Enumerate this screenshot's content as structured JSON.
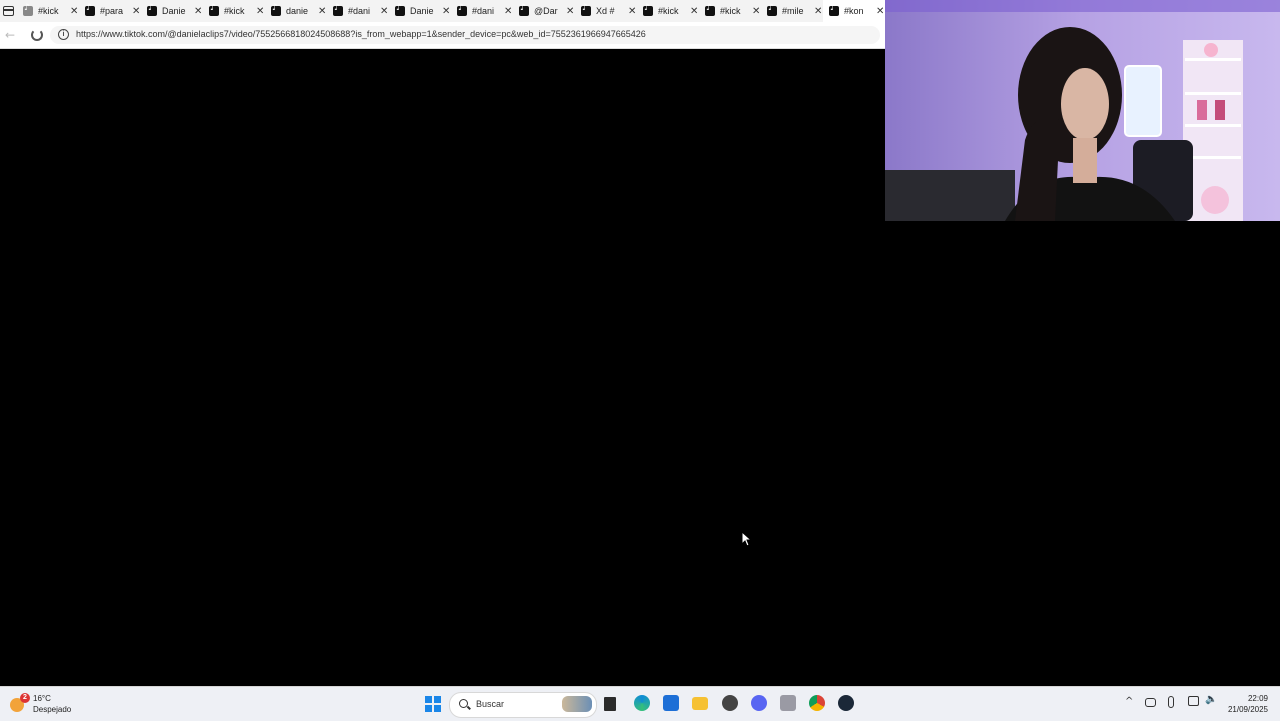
{
  "browser": {
    "tabs": [
      {
        "title": "#kick",
        "favicon": "grey-page-icon",
        "active": false
      },
      {
        "title": "#para",
        "favicon": "tiktok-icon",
        "active": false
      },
      {
        "title": "Danie",
        "favicon": "tiktok-icon",
        "active": false
      },
      {
        "title": "#kick",
        "favicon": "tiktok-icon",
        "active": false
      },
      {
        "title": "danie",
        "favicon": "tiktok-icon",
        "active": false
      },
      {
        "title": "#dani",
        "favicon": "tiktok-icon",
        "active": false
      },
      {
        "title": "Danie",
        "favicon": "tiktok-icon",
        "active": false
      },
      {
        "title": "#dani",
        "favicon": "tiktok-icon",
        "active": false
      },
      {
        "title": "@Dar",
        "favicon": "tiktok-icon",
        "active": false
      },
      {
        "title": "Xd #",
        "favicon": "tiktok-icon",
        "active": false
      },
      {
        "title": "#kick",
        "favicon": "tiktok-icon",
        "active": false
      },
      {
        "title": "#kick",
        "favicon": "tiktok-icon",
        "active": false
      },
      {
        "title": "#mile",
        "favicon": "tiktok-icon",
        "active": false
      },
      {
        "title": "#kon",
        "favicon": "tiktok-icon",
        "active": true
      }
    ],
    "tab_close_glyph": "✕",
    "url": "https://www.tiktok.com/@danielaclips7/video/7552566818024508688?is_from_webapp=1&sender_device=pc&web_id=7552361966947665426",
    "back_glyph": "←",
    "info_glyph": "i"
  },
  "taskbar": {
    "weather": {
      "temp": "16°C",
      "condition": "Despejado",
      "badge": "2"
    },
    "search_label": "Buscar",
    "tray_chevron": "^",
    "clock_time": "22:09",
    "clock_date": "21/09/2025"
  },
  "colors": {
    "accent": "#1a86e8",
    "video_bg": "#000000",
    "taskbar_bg": "#eef0f5",
    "webcam_bg": "#a38ad8"
  }
}
